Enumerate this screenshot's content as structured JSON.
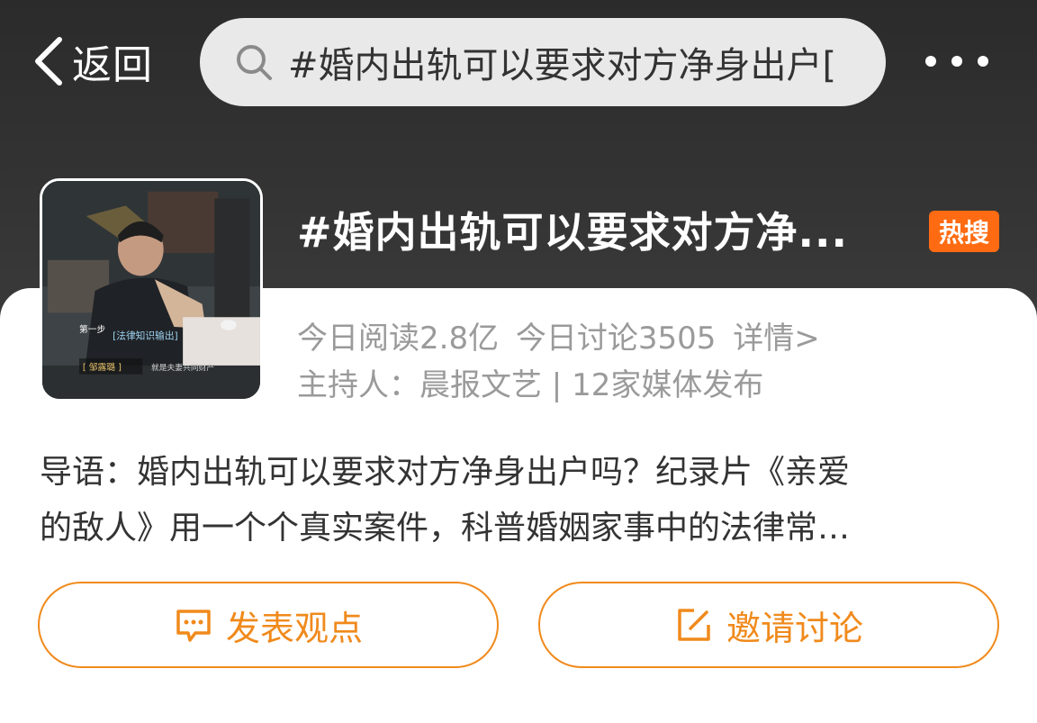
{
  "nav": {
    "back_label": "返回",
    "search_query": "#婚内出轨可以要求对方净身出户[",
    "more_label": "更多"
  },
  "topic": {
    "title": "#婚内出轨可以要求对方净...",
    "badge": "热搜",
    "read_today": "今日阅读2.8亿",
    "discuss_today": "今日讨论3505",
    "details_link": "详情>",
    "host": "主持人：晨报文艺 | 12家媒体发布",
    "cover": {
      "step_label": "第一步",
      "tag_label": "[法律知识输出]",
      "name_label": "[ 邹露璐 ]",
      "caption": "就是夫妻共同财产"
    }
  },
  "intro": {
    "line1": "导语：婚内出轨可以要求对方净身出户吗？纪录片《亲爱",
    "line2": "的敌人》用一个个真实案件，科普婚姻家事中的法律常…"
  },
  "actions": {
    "post_label": "发表观点",
    "invite_label": "邀请讨论"
  },
  "colors": {
    "accent": "#f08a1c",
    "hot_badge": "#ff6b12",
    "header_bg": "#333333"
  },
  "icons": {
    "back": "chevron-left-icon",
    "search": "search-icon",
    "more": "more-dots-icon",
    "post": "comment-icon",
    "invite": "edit-icon"
  }
}
